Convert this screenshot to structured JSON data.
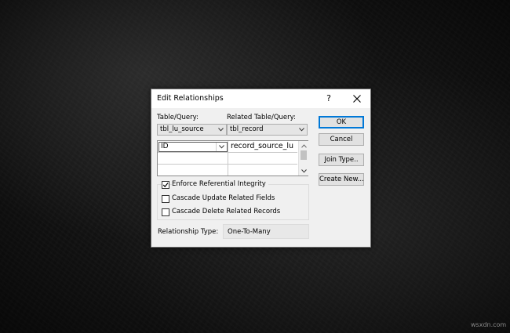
{
  "dialog": {
    "title": "Edit Relationships",
    "help_label": "?",
    "table_query_label": "Table/Query:",
    "related_table_query_label": "Related Table/Query:",
    "table_query_value": "tbl_lu_source",
    "related_table_query_value": "tbl_record",
    "fields_grid": {
      "rows": [
        {
          "primary": "ID",
          "related": "record_source_lu"
        },
        {
          "primary": "",
          "related": ""
        },
        {
          "primary": "",
          "related": ""
        }
      ]
    },
    "options": {
      "enforce_referential_integrity": {
        "label": "Enforce Referential Integrity",
        "checked": true
      },
      "cascade_update": {
        "label": "Cascade Update Related Fields",
        "checked": false
      },
      "cascade_delete": {
        "label": "Cascade Delete Related Records",
        "checked": false
      }
    },
    "relationship_type_label": "Relationship Type:",
    "relationship_type_value": "One-To-Many",
    "buttons": {
      "ok": "OK",
      "cancel": "Cancel",
      "join_type": "Join Type..",
      "create_new": "Create New..."
    }
  },
  "watermark": "wsxdn.com",
  "colors": {
    "dialog_bg": "#f0f0f0",
    "default_button_border": "#0078d7",
    "background": "#151515"
  }
}
